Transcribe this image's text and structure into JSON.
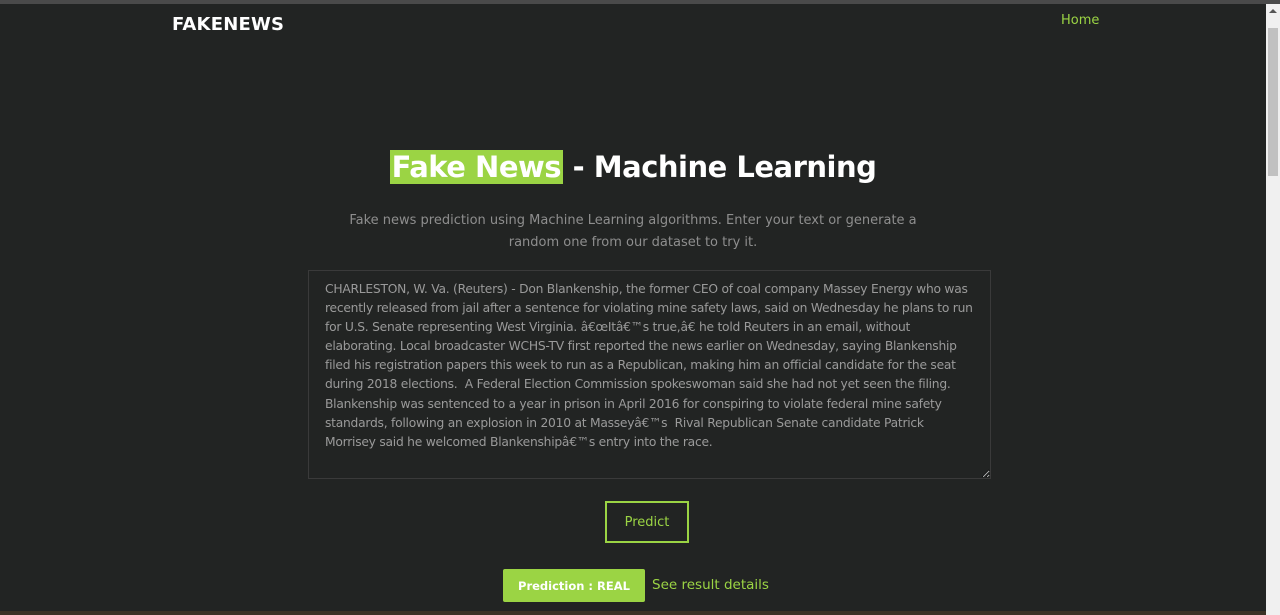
{
  "nav": {
    "brand": "FAKENEWS",
    "home": "Home"
  },
  "hero": {
    "title_highlight": "Fake News",
    "title_rest": " - Machine Learning",
    "subtitle": "Fake news prediction using Machine Learning algorithms. Enter your text or generate a random one from our dataset to try it."
  },
  "form": {
    "text": "CHARLESTON, W. Va. (Reuters) - Don Blankenship, the former CEO of coal company Massey Energy who was recently released from jail after a sentence for violating mine safety laws, said on Wednesday he plans to run for U.S. Senate representing West Virginia. â€œItâ€™s true,â€ he told Reuters in an email, without elaborating. Local broadcaster WCHS-TV first reported the news earlier on Wednesday, saying Blankenship filed his registration papers this week to run as a Republican, making him an official candidate for the seat during 2018 elections.  A Federal Election Commission spokeswoman said she had not yet seen the filing. Blankenship was sentenced to a year in prison in April 2016 for conspiring to violate federal mine safety standards, following an explosion in 2010 at Masseyâ€™s  Rival Republican Senate candidate Patrick Morrisey said he welcomed Blankenshipâ€™s entry into the race.",
    "predict_label": "Predict"
  },
  "result": {
    "label": "Prediction : REAL",
    "details_link": "See result details"
  },
  "colors": {
    "accent": "#9bd444",
    "background": "#222423"
  }
}
